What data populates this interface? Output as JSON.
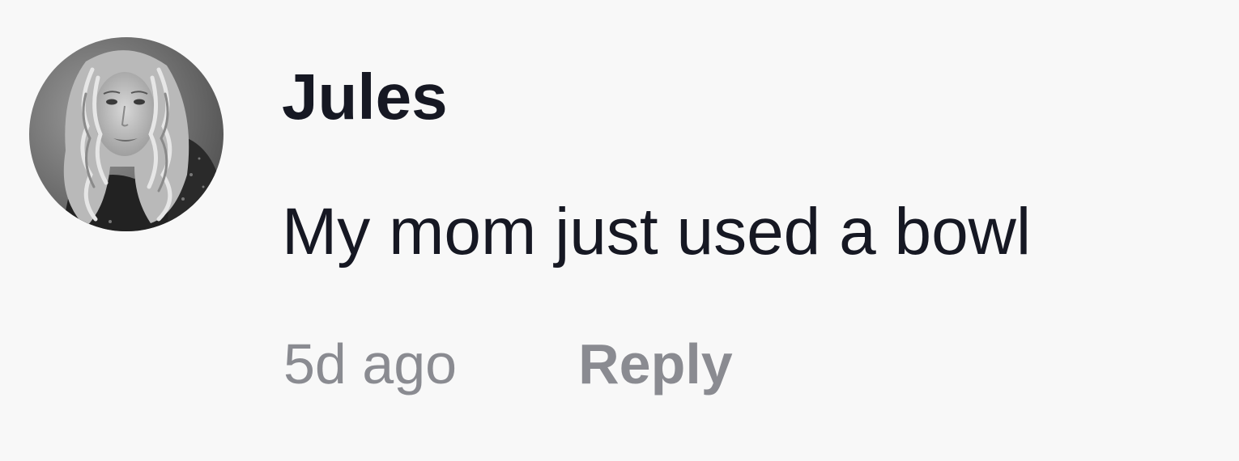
{
  "comment": {
    "username": "Jules",
    "text": "My mom just used a bowl",
    "timestamp": "5d ago",
    "reply_label": "Reply"
  },
  "colors": {
    "background": "#f8f8f8",
    "primary_text": "#161823",
    "secondary_text": "#8a8b91"
  },
  "icons": {
    "avatar": "user-avatar-photo"
  }
}
